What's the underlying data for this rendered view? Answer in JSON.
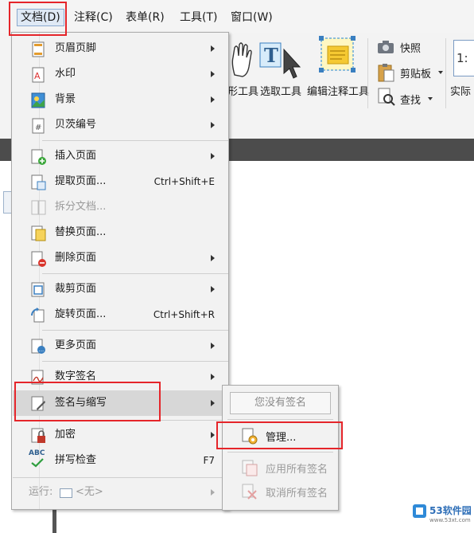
{
  "menubar": {
    "items": [
      "文档(D)",
      "注释(C)",
      "表单(R)",
      "工具(T)",
      "窗口(W)"
    ]
  },
  "ribbon": {
    "hand_tool_suffix": "形工具",
    "select_tool": "选取工具",
    "edit_annot_tool": "编辑注释工具",
    "snapshot": "快照",
    "clipboard": "剪贴板",
    "find": "查找",
    "actual_size_partial": "实际",
    "actual_size_icon_text": "1:"
  },
  "main_menu": {
    "items": [
      {
        "label": "页眉页脚",
        "shortcut": "",
        "arrow": true,
        "disabled": false
      },
      {
        "label": "水印",
        "shortcut": "",
        "arrow": true,
        "disabled": false
      },
      {
        "label": "背景",
        "shortcut": "",
        "arrow": true,
        "disabled": false
      },
      {
        "label": "贝茨编号",
        "shortcut": "",
        "arrow": true,
        "disabled": false
      },
      {
        "label": "插入页面",
        "shortcut": "",
        "arrow": true,
        "disabled": false
      },
      {
        "label": "提取页面...",
        "shortcut": "Ctrl+Shift+E",
        "arrow": false,
        "disabled": false
      },
      {
        "label": "拆分文档...",
        "shortcut": "",
        "arrow": false,
        "disabled": true
      },
      {
        "label": "替换页面...",
        "shortcut": "",
        "arrow": false,
        "disabled": false
      },
      {
        "label": "删除页面",
        "shortcut": "",
        "arrow": true,
        "disabled": false
      },
      {
        "label": "裁剪页面",
        "shortcut": "",
        "arrow": true,
        "disabled": false
      },
      {
        "label": "旋转页面...",
        "shortcut": "Ctrl+Shift+R",
        "arrow": false,
        "disabled": false
      },
      {
        "label": "更多页面",
        "shortcut": "",
        "arrow": true,
        "disabled": false
      },
      {
        "label": "数字签名",
        "shortcut": "",
        "arrow": true,
        "disabled": false
      },
      {
        "label": "签名与缩写",
        "shortcut": "",
        "arrow": true,
        "disabled": false
      },
      {
        "label": "加密",
        "shortcut": "",
        "arrow": true,
        "disabled": false
      },
      {
        "label": "拼写检查",
        "shortcut": "F7",
        "arrow": false,
        "disabled": false
      },
      {
        "label": "运行:",
        "shortcut": "",
        "arrow": true,
        "disabled": true,
        "extra": "<无>"
      }
    ]
  },
  "sub_menu": {
    "no_signature": "您没有签名",
    "manage": "管理...",
    "apply_all": "应用所有签名",
    "cancel_all": "取消所有签名"
  },
  "icons": {
    "abc": "ABC"
  },
  "watermark": {
    "logo_text": "53软件园",
    "url": "www.53xt.com"
  },
  "colors": {
    "highlight_red": "#e5252a",
    "menu_bg": "#f2f2f2",
    "dark_bar": "#4c4c4c"
  }
}
